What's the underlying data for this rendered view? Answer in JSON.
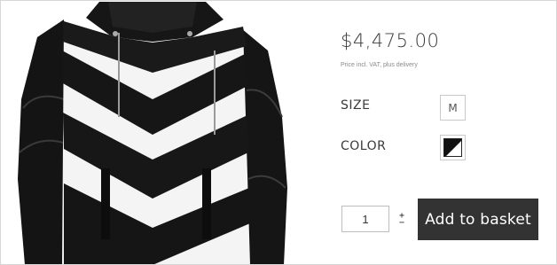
{
  "product": {
    "image_alt": "Black and white chevron panel leather hooded jacket",
    "price": "$4,475.00",
    "price_note": "Price incl. VAT, plus delivery"
  },
  "options": {
    "size_label": "SIZE",
    "size_value": "M",
    "color_label": "COLOR",
    "color_swatch_colors": [
      "#111111",
      "#ffffff"
    ]
  },
  "purchase": {
    "quantity": "1",
    "stepper_plus": "+",
    "stepper_minus": "−",
    "add_to_basket_label": "Add to basket"
  },
  "colors": {
    "button_bg": "#333333",
    "button_text": "#ffffff",
    "border": "#d6d6d6"
  }
}
